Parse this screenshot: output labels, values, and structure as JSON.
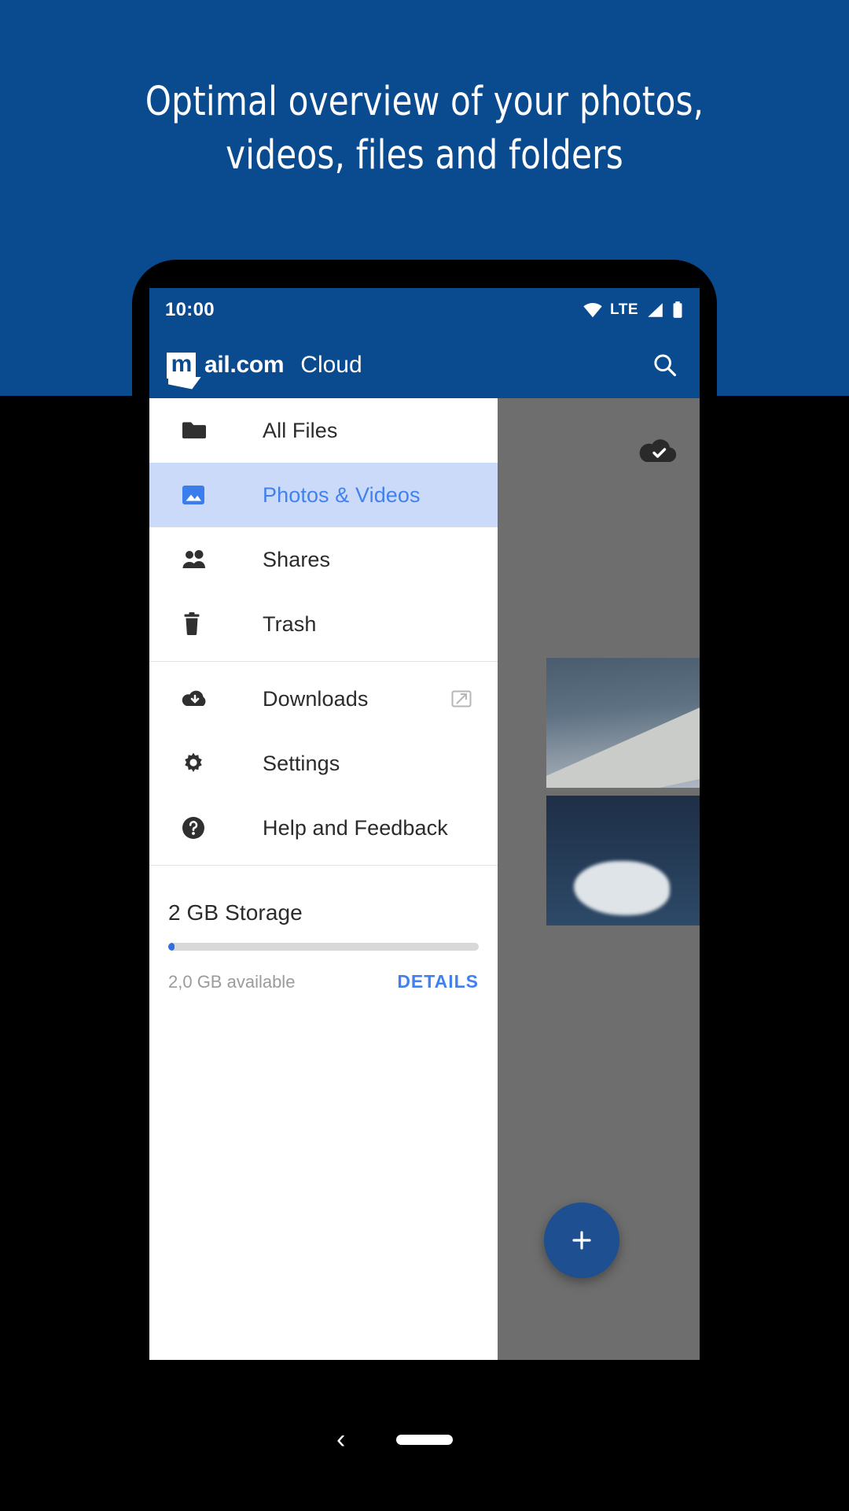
{
  "promo": {
    "headline_line1": "Optimal overview of your photos,",
    "headline_line2": "videos, files and folders",
    "bg_color": "#0a4a8f"
  },
  "status_bar": {
    "time": "10:00",
    "network_label": "LTE",
    "wifi_icon": "wifi-icon",
    "signal_icon": "signal-icon",
    "battery_icon": "battery-icon"
  },
  "app_bar": {
    "logo_letter": "m",
    "logo_text": "ail.com",
    "product_name": "Cloud",
    "search_icon": "search-icon"
  },
  "drawer": {
    "items": [
      {
        "label": "All Files",
        "icon": "folder-icon",
        "active": false,
        "trailing": null
      },
      {
        "label": "Photos & Videos",
        "icon": "image-icon",
        "active": true,
        "trailing": null
      },
      {
        "label": "Shares",
        "icon": "people-icon",
        "active": false,
        "trailing": null
      },
      {
        "label": "Trash",
        "icon": "trash-icon",
        "active": false,
        "trailing": null
      },
      {
        "label": "Downloads",
        "icon": "cloud-download-icon",
        "active": false,
        "trailing": "external-link-icon"
      },
      {
        "label": "Settings",
        "icon": "gear-icon",
        "active": false,
        "trailing": null
      },
      {
        "label": "Help and Feedback",
        "icon": "help-circle-icon",
        "active": false,
        "trailing": null
      }
    ],
    "storage": {
      "title": "2 GB Storage",
      "available": "2,0 GB available",
      "details_label": "DETAILS",
      "used_percent": 2,
      "accent_color": "#4181ef"
    }
  },
  "content": {
    "cloud_check_icon": "cloud-check-icon",
    "fab_icon": "plus-icon",
    "fab_color": "#1d4f91",
    "tiles": [
      {
        "name": "airplane-wing-photo"
      },
      {
        "name": "cloudy-sky-photo"
      }
    ]
  },
  "nav_bar": {
    "back_icon": "back-chevron-icon",
    "home_pill": "home-pill"
  }
}
